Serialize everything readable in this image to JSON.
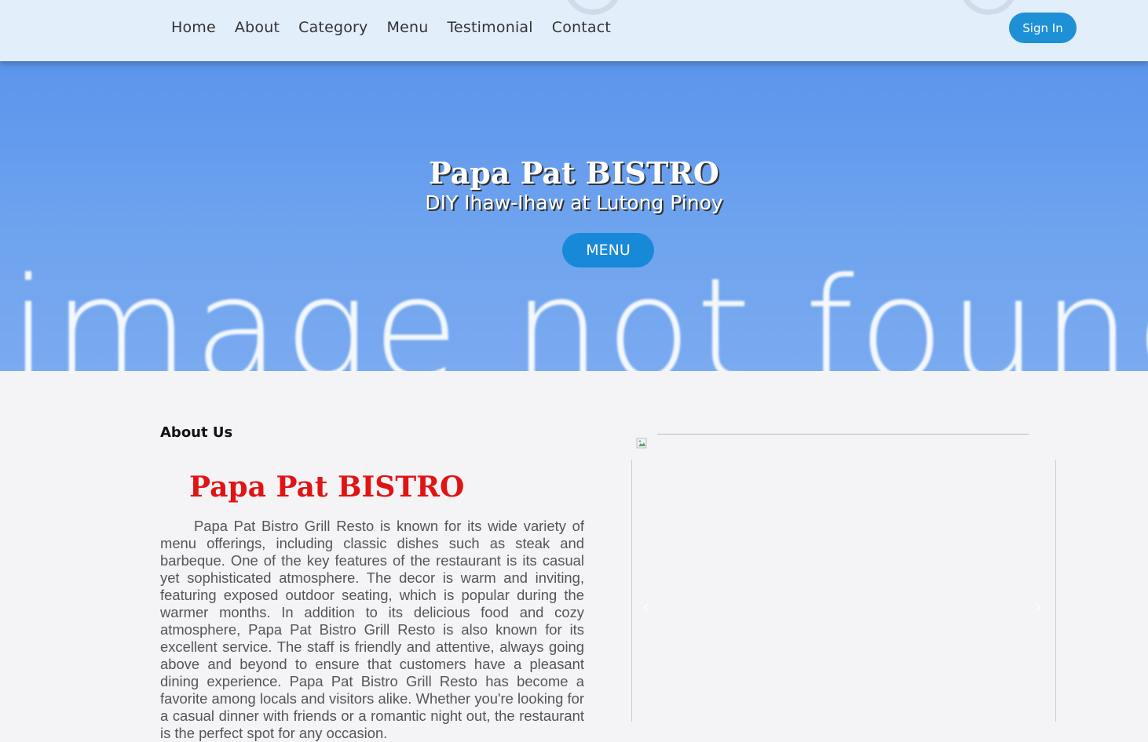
{
  "nav": {
    "items": [
      {
        "label": "Home"
      },
      {
        "label": "About"
      },
      {
        "label": "Category"
      },
      {
        "label": "Menu"
      },
      {
        "label": "Testimonial"
      },
      {
        "label": "Contact"
      }
    ],
    "sign_in_label": "Sign In"
  },
  "hero": {
    "title": "Papa Pat BISTRO",
    "subtitle": "DIY Ihaw-Ihaw at Lutong Pinoy",
    "menu_button_label": "MENU",
    "background_placeholder": "image not found"
  },
  "about": {
    "heading": "About Us",
    "title": "Papa Pat BISTRO",
    "body": "Papa Pat Bistro Grill Resto is known for its wide variety of menu offerings, including classic dishes such as steak and barbeque. One of the key features of the restaurant is its casual yet sophisticated atmosphere. The decor is warm and inviting, featuring exposed outdoor seating, which is popular during the warmer months. In addition to its delicious food and cozy atmosphere, Papa Pat Bistro Grill Resto is also known for its excellent service. The staff is friendly and attentive, always going above and beyond to ensure that customers have a pleasant dining experience. Papa Pat Bistro Grill Resto has become a favorite among locals and visitors alike. Whether you're looking for a casual dinner with friends or a romantic night out, the restaurant is the perfect spot for any occasion."
  },
  "carousel": {
    "prev_icon": "chevron-left-icon",
    "next_icon": "chevron-right-icon",
    "prev_glyph": "‹",
    "next_glyph": "›"
  },
  "colors": {
    "accent": "#1e90d6",
    "title_red": "#e01414",
    "hero_blue": "#5b95ec"
  }
}
